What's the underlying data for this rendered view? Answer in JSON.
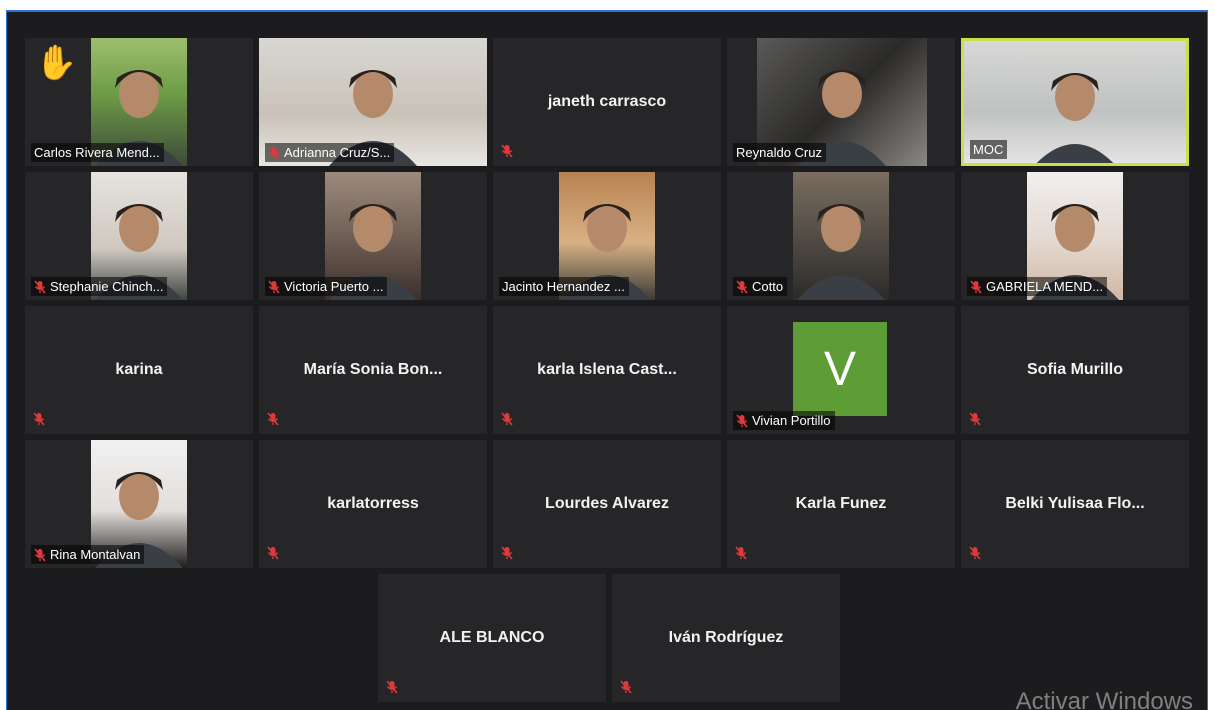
{
  "meeting": {
    "rows": [
      [
        {
          "name": "Carlos Rivera Mend...",
          "video": true,
          "muted": false,
          "hand_raised": true,
          "hand_icon": "raised-hand-icon",
          "scene": "outdoor-green"
        },
        {
          "name": "Adrianna Cruz/S...",
          "video": true,
          "muted": true,
          "scene": "indoor-white"
        },
        {
          "name": "janeth carrasco",
          "video": false,
          "muted": true
        },
        {
          "name": "Reynaldo Cruz",
          "video": true,
          "muted": false,
          "scene": "dark-room"
        },
        {
          "name": "MOC",
          "video": true,
          "muted": false,
          "active_speaker": true,
          "scene": "office"
        }
      ],
      [
        {
          "name": "Stephanie Chinch...",
          "video": true,
          "muted": true,
          "scene": "indoor-light"
        },
        {
          "name": "Victoria Puerto ...",
          "video": true,
          "muted": true,
          "scene": "indoor-warm"
        },
        {
          "name": "Jacinto Hernandez ...",
          "video": true,
          "muted": false,
          "scene": "indoor-warm"
        },
        {
          "name": "Cotto",
          "video": true,
          "muted": true,
          "scene": "indoor-dim"
        },
        {
          "name": "GABRIELA MEND...",
          "video": true,
          "muted": true,
          "scene": "indoor-light"
        }
      ],
      [
        {
          "name": "karina",
          "video": false,
          "muted": true
        },
        {
          "name": "María Sonia Bon...",
          "video": false,
          "muted": true
        },
        {
          "name": "karla Islena Cast...",
          "video": false,
          "muted": true
        },
        {
          "name": "Vivian Portillo",
          "video": false,
          "muted": true,
          "avatar_letter": "V"
        },
        {
          "name": "Sofia Murillo",
          "video": false,
          "muted": true
        }
      ],
      [
        {
          "name": "Rina Montalvan",
          "video": true,
          "muted": true,
          "scene": "indoor-light"
        },
        {
          "name": "karlatorress",
          "video": false,
          "muted": true
        },
        {
          "name": "Lourdes Alvarez",
          "video": false,
          "muted": true
        },
        {
          "name": "Karla Funez",
          "video": false,
          "muted": true
        },
        {
          "name": "Belki Yulisaa Flo...",
          "video": false,
          "muted": true
        }
      ],
      [
        {
          "name": "ALE BLANCO",
          "video": false,
          "muted": true
        },
        {
          "name": "Iván Rodríguez",
          "video": false,
          "muted": true
        }
      ]
    ]
  },
  "watermark": "Activar Windows",
  "colors": {
    "background": "#1c1c1e",
    "tile": "#262628",
    "active_border": "#c9e04a",
    "avatar": "#5e9c35",
    "mute": "#e0383b"
  },
  "icons": {
    "muted": "muted-mic-icon"
  }
}
